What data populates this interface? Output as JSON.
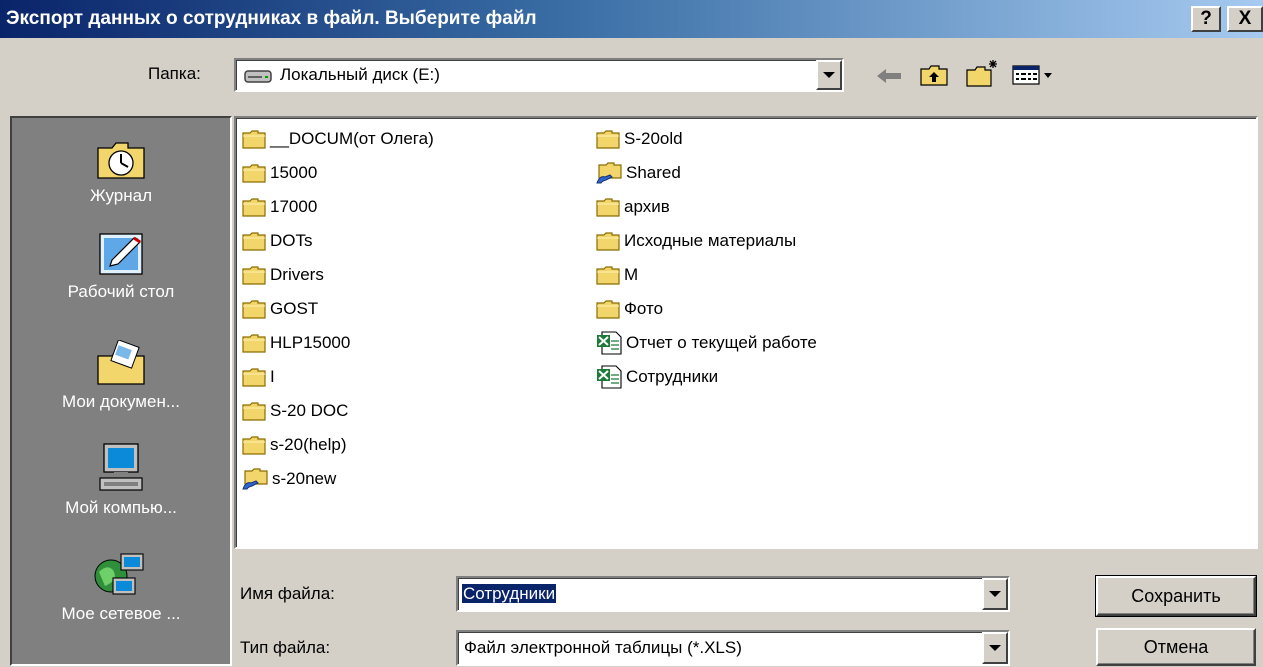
{
  "window": {
    "title": "Экспорт данных о сотрудниках в файл. Выберите файл",
    "help_label": "?",
    "close_label": "X"
  },
  "folder": {
    "label": "Папка:",
    "value": "Локальный диск (E:)"
  },
  "toolbar": {
    "back_icon": "back-arrow-icon",
    "up_icon": "up-folder-icon",
    "new_folder_icon": "new-folder-icon",
    "view_icon": "view-menu-icon"
  },
  "places": [
    {
      "label": "Журнал",
      "icon": "history-icon"
    },
    {
      "label": "Рабочий стол",
      "icon": "desktop-icon"
    },
    {
      "label": "Мои докумен...",
      "icon": "my-documents-icon"
    },
    {
      "label": "Мой компью...",
      "icon": "my-computer-icon"
    },
    {
      "label": "Мое сетевое ...",
      "icon": "network-icon"
    }
  ],
  "files": {
    "col1": [
      {
        "name": "__DOCUM(от Олега)",
        "type": "folder"
      },
      {
        "name": "15000",
        "type": "folder"
      },
      {
        "name": "17000",
        "type": "folder"
      },
      {
        "name": "DOTs",
        "type": "folder"
      },
      {
        "name": "Drivers",
        "type": "folder"
      },
      {
        "name": "GOST",
        "type": "folder"
      },
      {
        "name": "HLP15000",
        "type": "folder"
      },
      {
        "name": "I",
        "type": "folder"
      },
      {
        "name": "S-20 DOC",
        "type": "folder"
      },
      {
        "name": "s-20(help)",
        "type": "folder"
      },
      {
        "name": "s-20new",
        "type": "shared-folder"
      }
    ],
    "col2": [
      {
        "name": "S-20old",
        "type": "folder"
      },
      {
        "name": "Shared",
        "type": "shared-folder"
      },
      {
        "name": "архив",
        "type": "folder"
      },
      {
        "name": "Исходные материалы",
        "type": "folder"
      },
      {
        "name": "M",
        "type": "folder"
      },
      {
        "name": "Фото",
        "type": "folder"
      },
      {
        "name": "Отчет о текущей работе",
        "type": "excel-file"
      },
      {
        "name": "Сотрудники",
        "type": "excel-file"
      }
    ]
  },
  "filename": {
    "label": "Имя файла:",
    "value": "Сотрудники"
  },
  "filetype": {
    "label": "Тип файла:",
    "value": "Файл электронной таблицы (*.XLS)"
  },
  "buttons": {
    "save": "Сохранить",
    "cancel": "Отмена"
  },
  "colors": {
    "title_start": "#0a246a",
    "title_end": "#a6caf0",
    "face": "#d4d0c8",
    "places_bg": "#808080",
    "folder": "#f2d66b",
    "excel": "#1d7a38"
  }
}
